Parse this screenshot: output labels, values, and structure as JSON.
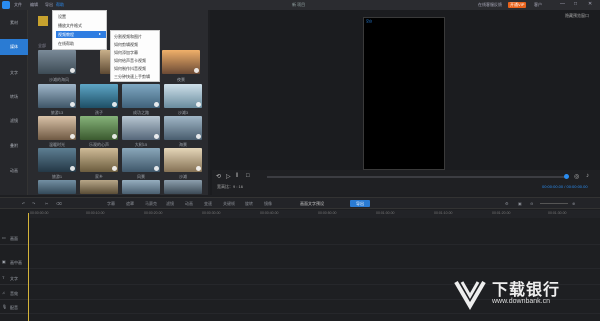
{
  "titlebar": {
    "menus": [
      "文件",
      "编辑",
      "导出",
      "帮助"
    ],
    "filename": "新 项目",
    "right_items": [
      "在线客服",
      "反馈",
      "客户"
    ],
    "tag": "开通VIP",
    "win_controls": [
      "—",
      "□",
      "✕"
    ]
  },
  "leftnav": {
    "items": [
      "素材",
      "媒体",
      "文字",
      "转场",
      "滤镜",
      "叠附",
      "动画"
    ],
    "active_index": 1
  },
  "library": {
    "filter_label": "全部",
    "thumb_labels": [
      "",
      "",
      "",
      "沙滩的海风",
      "",
      "",
      "旅行",
      "",
      "",
      "",
      "",
      "",
      "",
      "",
      "",
      "",
      "",
      "",
      "沙滩",
      "",
      ""
    ],
    "visible_labels": {
      "r1": [
        "沙滩的海风",
        "野餐",
        "夜景"
      ],
      "r2": [
        "旅游13",
        "孩子",
        "成功之路",
        "沙滩3"
      ],
      "r3": [
        "温暖时光",
        "乐观的心声",
        "大树15",
        "海景"
      ],
      "r4": [
        "旅游1",
        "家乡",
        "风景",
        "沙滩"
      ]
    }
  },
  "context_menu": {
    "items": [
      "设置",
      "播放文件格式",
      "视频教程",
      "在线帮助"
    ],
    "highlight_index": 2
  },
  "sub_menu": {
    "items": [
      "分割视频和图片",
      "如何剪辑视频",
      "如何添加字幕",
      "如何给声音卡视频",
      "如何制作抖音视频",
      "三分钟快速上手剪辑"
    ]
  },
  "preview": {
    "top_right_text": "隐藏预览窗口",
    "aspect_label": "宽高比：9 : 16",
    "timecode": "00:00:00.00 / 00:00:00.00",
    "canvas_tag": "空白"
  },
  "toolbar": {
    "items": [
      "字幕",
      "遮罩",
      "马赛克",
      "滤镜",
      "动画",
      "变速",
      "关键帧",
      "旋转",
      "镜像"
    ],
    "suggestion": "画面文字预设",
    "export_label": "导出"
  },
  "ruler": {
    "ticks": [
      "00:00:00.00",
      "00:00:10.00",
      "00:00:20.00",
      "00:00:30.00",
      "00:00:40.00",
      "00:00:50.00",
      "00:01:00.00",
      "00:01:10.00",
      "00:01:20.00",
      "00:01:30.00",
      "00:01:40.00"
    ]
  },
  "tracks": {
    "heads": [
      "画面",
      "画中画",
      "文字",
      "音效",
      "配音"
    ]
  },
  "watermark": {
    "text": "下载银行",
    "url": "www.downbank.cn"
  },
  "colors": {
    "accent": "#2a8cf0",
    "active_nav": "#2a7bd3",
    "vip": "#e8631c",
    "playhead": "#d4b43a"
  }
}
